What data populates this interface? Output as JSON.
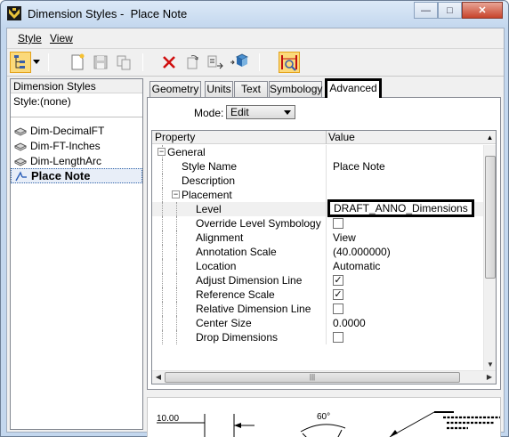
{
  "window": {
    "title": "Dimension Styles -  Place Note",
    "minimize_glyph": "—",
    "maximize_glyph": "□",
    "close_glyph": "✕"
  },
  "menu": {
    "style_label": "Style",
    "view_label": "View"
  },
  "toolbar": {
    "icons": [
      "tree-view-icon",
      "new-style-icon",
      "save-icon",
      "copy-icon",
      "delete-icon",
      "reset-icon",
      "compare-icon",
      "import-icon",
      "preview-match-icon"
    ]
  },
  "left_panel": {
    "header": "Dimension Styles",
    "active_style": "Style:(none)",
    "items": [
      {
        "label": "Dim-DecimalFT",
        "icon": "dimension-style-icon"
      },
      {
        "label": "Dim-FT-Inches",
        "icon": "dimension-style-icon"
      },
      {
        "label": "Dim-LengthArc",
        "icon": "dimension-style-icon"
      },
      {
        "label": "Place Note",
        "icon": "note-style-icon",
        "selected": true
      }
    ]
  },
  "tabs": [
    {
      "label": "Geometry"
    },
    {
      "label": "Units"
    },
    {
      "label": "Text"
    },
    {
      "label": "Symbology"
    },
    {
      "label": "Advanced",
      "active": true
    }
  ],
  "advanced": {
    "mode_label": "Mode:",
    "mode_value": "Edit",
    "grid": {
      "col_property": "Property",
      "col_value": "Value",
      "rows": [
        {
          "label": "General",
          "kind": "group",
          "expanded": true
        },
        {
          "label": "Style Name",
          "value": "Place Note"
        },
        {
          "label": "Description",
          "value": ""
        },
        {
          "label": "Placement",
          "kind": "group",
          "expanded": true
        },
        {
          "label": "Level",
          "value": "DRAFT_ANNO_Dimensions"
        },
        {
          "label": "Override Level Symbology",
          "checked": false
        },
        {
          "label": "Alignment",
          "value": "View"
        },
        {
          "label": "Annotation Scale",
          "value": "(40.000000)"
        },
        {
          "label": "Location",
          "value": "Automatic"
        },
        {
          "label": "Adjust Dimension Line",
          "checked": true
        },
        {
          "label": "Reference Scale",
          "checked": true
        },
        {
          "label": "Relative Dimension Line",
          "checked": false
        },
        {
          "label": "Center Size",
          "value": "0.0000"
        },
        {
          "label": "Drop Dimensions",
          "checked": false
        }
      ]
    }
  },
  "preview": {
    "linear_value": "10.00",
    "angle_value": "60°"
  }
}
